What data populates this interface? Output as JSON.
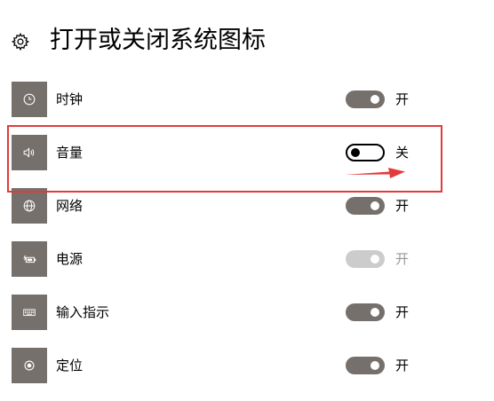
{
  "header": {
    "icon": "gear-icon",
    "title": "打开或关闭系统图标"
  },
  "items": [
    {
      "label": "时钟",
      "icon": "clock-icon",
      "state": "on",
      "state_text": "开"
    },
    {
      "label": "音量",
      "icon": "volume-icon",
      "state": "off",
      "state_text": "关"
    },
    {
      "label": "网络",
      "icon": "network-globe-icon",
      "state": "on",
      "state_text": "开"
    },
    {
      "label": "电源",
      "icon": "battery-power-icon",
      "state": "on",
      "disabled": true,
      "state_text": "开"
    },
    {
      "label": "输入指示",
      "icon": "keyboard-icon",
      "state": "on",
      "state_text": "开"
    },
    {
      "label": "定位",
      "icon": "location-icon",
      "state": "on",
      "state_text": "开"
    }
  ],
  "annotation": {
    "highlighted_item": "音量",
    "color": "#e23b3b"
  }
}
